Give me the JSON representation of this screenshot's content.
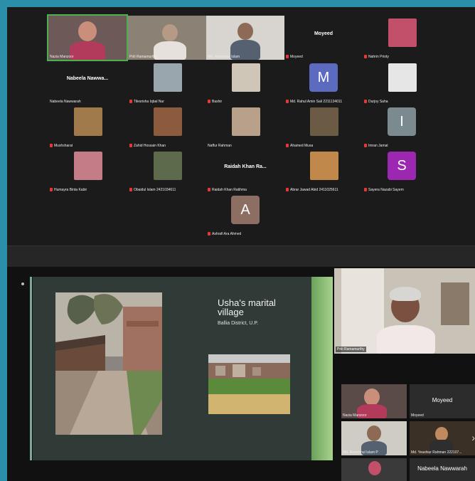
{
  "top_gallery": {
    "row1": [
      {
        "name": "Nazia Manzoor",
        "type": "video"
      },
      {
        "name": "Priti Ramamurthy",
        "type": "video"
      },
      {
        "name": "Md. Rowshnul Islam",
        "type": "video"
      },
      {
        "name": "Moyeed",
        "type": "text",
        "display": "Moyeed"
      },
      {
        "name": "Nahrin Prioty",
        "type": "small"
      }
    ],
    "row2": [
      {
        "name": "Nabeela Nawwarah",
        "type": "text",
        "display": "Nabeela Nawwa..."
      },
      {
        "name": "Tilesrisha Iqbal Nur",
        "type": "small"
      },
      {
        "name": "Bashir",
        "type": "small"
      },
      {
        "name": "Md. Rahul Amin Sali 2211134011",
        "type": "avatar",
        "letter": "M",
        "color": "#5c6bc0"
      },
      {
        "name": "Durjoy Saha",
        "type": "small"
      }
    ],
    "row3": [
      {
        "name": "Mushsharat",
        "type": "small"
      },
      {
        "name": "Zahid Hossain Khan",
        "type": "small"
      },
      {
        "name": "Naffur Rahman",
        "type": "small"
      },
      {
        "name": "Ahamed Musa",
        "type": "small"
      },
      {
        "name": "Imran Jamal",
        "type": "avatar",
        "letter": "I",
        "color": "#7b8a8f"
      }
    ],
    "row4": [
      {
        "name": "Humayra Binta Kabir",
        "type": "small"
      },
      {
        "name": "Obaidul Islam 2421034611",
        "type": "small"
      },
      {
        "name": "Raidah Khan Ratihma",
        "type": "text",
        "display": "Raidah Khan Ra..."
      },
      {
        "name": "Abrar Jawad Abid 2411025611",
        "type": "small"
      },
      {
        "name": "Sayera Nazabi Sayem",
        "type": "avatar",
        "letter": "S",
        "color": "#9c27b0"
      }
    ],
    "row5": [
      {
        "name": "Ashrafi Ara Ahmed",
        "type": "avatar",
        "letter": "A",
        "color": "#8d6e63"
      }
    ]
  },
  "slide": {
    "title": "Usha's marital village",
    "subtitle": "Ballia District, U.P."
  },
  "speaker": {
    "name": "Priti Ramamurthy"
  },
  "side_gallery": [
    {
      "name": "Nazia Manzoor",
      "type": "video"
    },
    {
      "name": "Moyeed",
      "type": "text",
      "display": "Moyeed"
    },
    {
      "name": "Md. Rowshnul Islam P",
      "type": "video"
    },
    {
      "name": "Md. Yeashiur Rahman 222107...",
      "type": "video"
    },
    {
      "name": "",
      "type": "video"
    },
    {
      "name": "Nabeela Nawwarah",
      "type": "text",
      "display": "Nabeela Nawwarah"
    }
  ],
  "icons": {
    "mic_muted": "mic-muted-icon",
    "next": "chevron-right-icon"
  },
  "colors": {
    "border": "#2a8fa8",
    "muted": "#e53935",
    "active_speaker": "#4caf50"
  }
}
